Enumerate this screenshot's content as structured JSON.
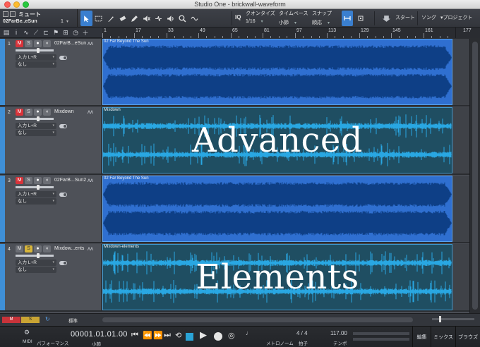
{
  "window": {
    "title": "Studio One - brickwall-waveform"
  },
  "toolbar": {
    "mute_label": "ミュート",
    "selected_track_name": "02FarBe..eSun",
    "selected_track_number": "1",
    "iq_label": "IQ",
    "quantize": {
      "label": "クオンタイズ",
      "value": "1/16"
    },
    "timebase": {
      "label": "タイムベース",
      "value": "小節"
    },
    "snap": {
      "label": "スナップ",
      "value": "順応"
    },
    "start_label": "スタート",
    "song_label": "ソング",
    "project_label": "プロジェクト",
    "accent_color": "#3a7fcf"
  },
  "ruler": {
    "ticks": [
      "1",
      "17",
      "33",
      "49",
      "65",
      "81",
      "97",
      "113",
      "129",
      "145",
      "161",
      "177"
    ]
  },
  "tracks": [
    {
      "number": "1",
      "name": "02FarB...eSun",
      "input": "入力 L+R",
      "output": "なし",
      "mute": true,
      "solo": false,
      "clip_label": "02 Far Beyond The Sun",
      "clip_style": "bright",
      "overlay": ""
    },
    {
      "number": "2",
      "name": "Mixdown",
      "input": "入力 L+R",
      "output": "なし",
      "mute": true,
      "solo": false,
      "clip_label": "Mixdown",
      "clip_style": "dark",
      "overlay": "Advanced"
    },
    {
      "number": "3",
      "name": "02FarB...Sun2",
      "input": "入力 L+R",
      "output": "なし",
      "mute": true,
      "solo": false,
      "clip_label": "02 Far Beyond The Sun",
      "clip_style": "bright",
      "overlay": ""
    },
    {
      "number": "4",
      "name": "Mixdow...ents",
      "input": "入力 L+R",
      "output": "なし",
      "mute": false,
      "solo": true,
      "clip_label": "Mixdown-elements",
      "clip_style": "dark",
      "overlay": "Elements"
    }
  ],
  "bottom": {
    "mute_all": "M",
    "solo_all": "S",
    "view_mode": "標準"
  },
  "transport": {
    "midi_label": "MIDI",
    "performance_label": "パフォーマンス",
    "position": "00001.01.01.00",
    "position_unit": "小節",
    "metronome_label": "メトロノーム",
    "time_signature": "4 / 4",
    "time_signature_label": "拍子",
    "tempo": "117.00",
    "tempo_label": "テンポ",
    "edit_label": "編集",
    "mix_label": "ミックス",
    "browse_label": "ブラウズ"
  }
}
